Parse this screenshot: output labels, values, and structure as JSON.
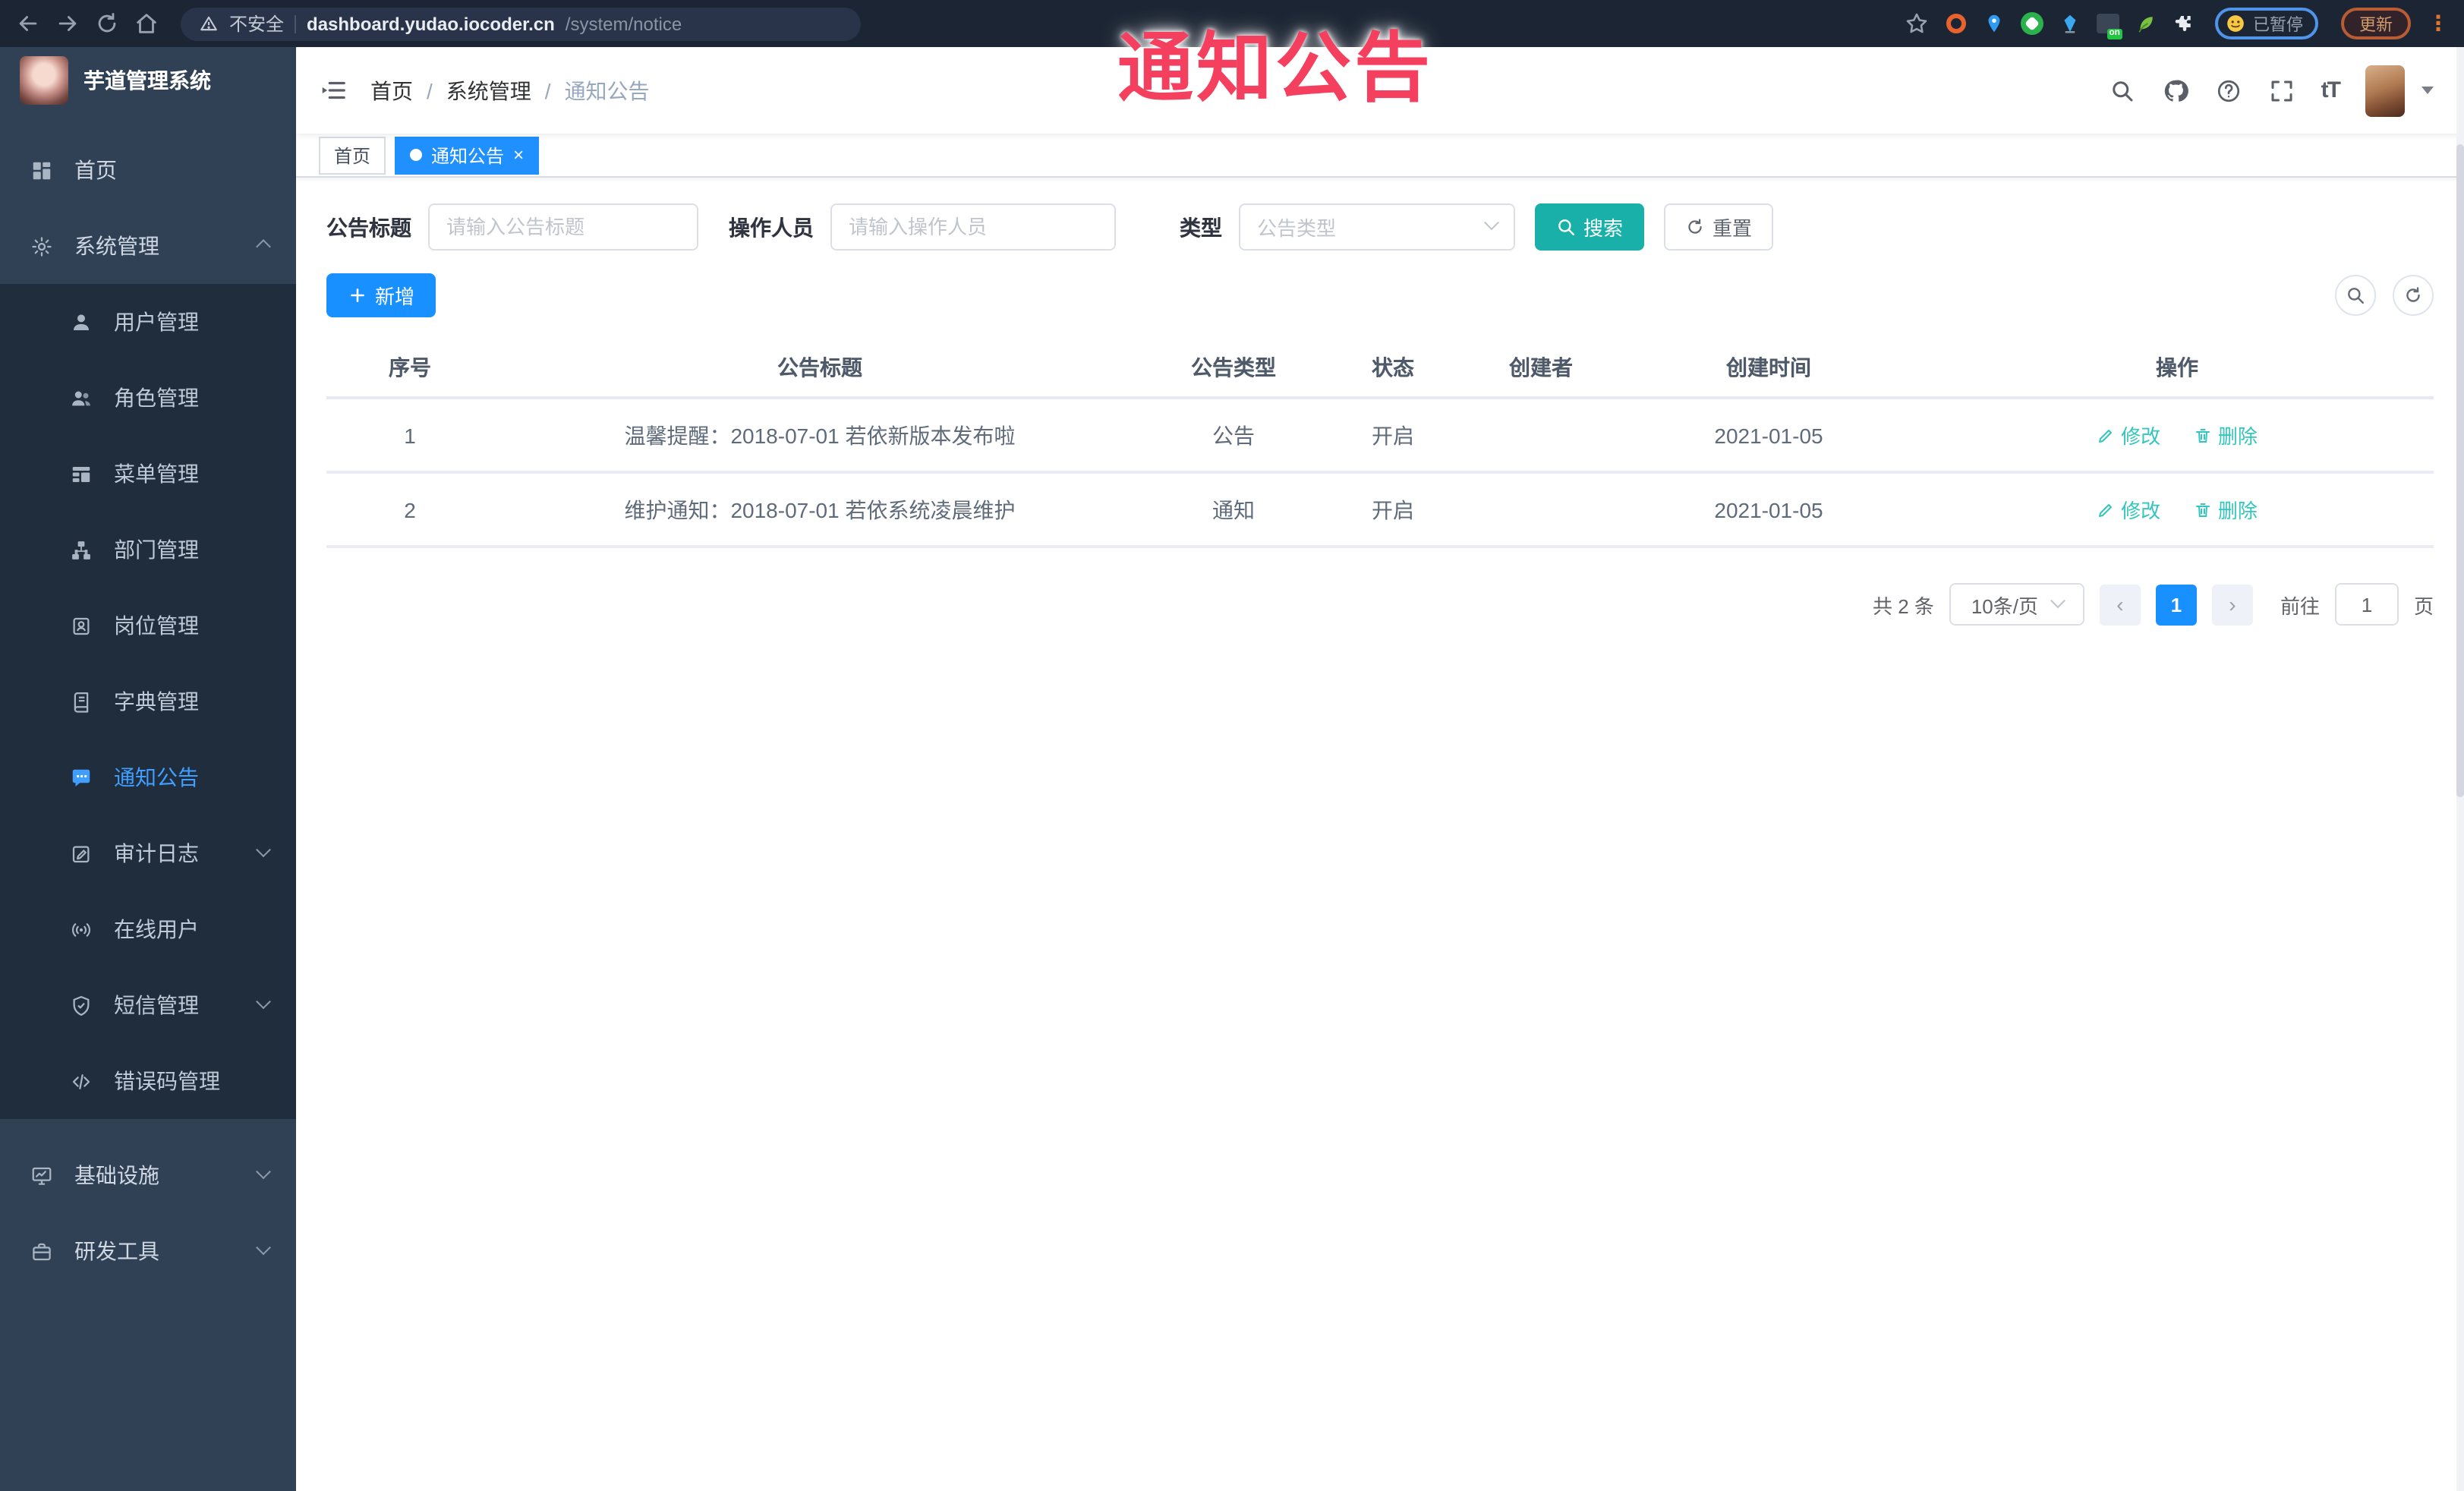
{
  "browser": {
    "security_label": "不安全",
    "url_host": "dashboard.yudao.iocoder.cn",
    "url_path": "/system/notice",
    "paused_label": "已暂停",
    "update_label": "更新"
  },
  "overlay_text": "通知公告",
  "sidebar": {
    "title": "芋道管理系统",
    "items": [
      {
        "label": "首页"
      },
      {
        "label": "系统管理"
      },
      {
        "label": "用户管理"
      },
      {
        "label": "角色管理"
      },
      {
        "label": "菜单管理"
      },
      {
        "label": "部门管理"
      },
      {
        "label": "岗位管理"
      },
      {
        "label": "字典管理"
      },
      {
        "label": "通知公告"
      },
      {
        "label": "审计日志"
      },
      {
        "label": "在线用户"
      },
      {
        "label": "短信管理"
      },
      {
        "label": "错误码管理"
      },
      {
        "label": "基础设施"
      },
      {
        "label": "研发工具"
      }
    ]
  },
  "breadcrumb": [
    "首页",
    "系统管理",
    "通知公告"
  ],
  "tabs": [
    {
      "label": "首页"
    },
    {
      "label": "通知公告"
    }
  ],
  "filters": {
    "title_label": "公告标题",
    "title_placeholder": "请输入公告标题",
    "operator_label": "操作人员",
    "operator_placeholder": "请输入操作人员",
    "type_label": "类型",
    "type_placeholder": "公告类型",
    "search_label": "搜索",
    "reset_label": "重置"
  },
  "toolbar": {
    "add_label": "新增"
  },
  "table": {
    "columns": [
      "序号",
      "公告标题",
      "公告类型",
      "状态",
      "创建者",
      "创建时间",
      "操作"
    ],
    "edit_label": "修改",
    "delete_label": "删除",
    "rows": [
      {
        "no": "1",
        "title": "温馨提醒：2018-07-01 若依新版本发布啦",
        "type": "公告",
        "status": "开启",
        "creator": "",
        "created": "2021-01-05"
      },
      {
        "no": "2",
        "title": "维护通知：2018-07-01 若依系统凌晨维护",
        "type": "通知",
        "status": "开启",
        "creator": "",
        "created": "2021-01-05"
      }
    ]
  },
  "pagination": {
    "total": "共 2 条",
    "page_size": "10条/页",
    "current": "1",
    "goto_label": "前往",
    "goto_value": "1",
    "unit_label": "页"
  },
  "glyphs": {
    "close": "×",
    "prev": "‹",
    "next": "›",
    "more": "⋮",
    "font_size": "tT"
  },
  "colors": {
    "primary_blue": "#2090ff",
    "add_blue": "#1890ff",
    "search_teal": "#18b0a8",
    "action_teal": "#33c5be",
    "sidebar_bg": "#304156",
    "submenu_bg": "#1f2d3d",
    "active_menu_text": "#409eff",
    "overlay_red": "#f4405e",
    "chrome_bg": "#1c2533"
  }
}
